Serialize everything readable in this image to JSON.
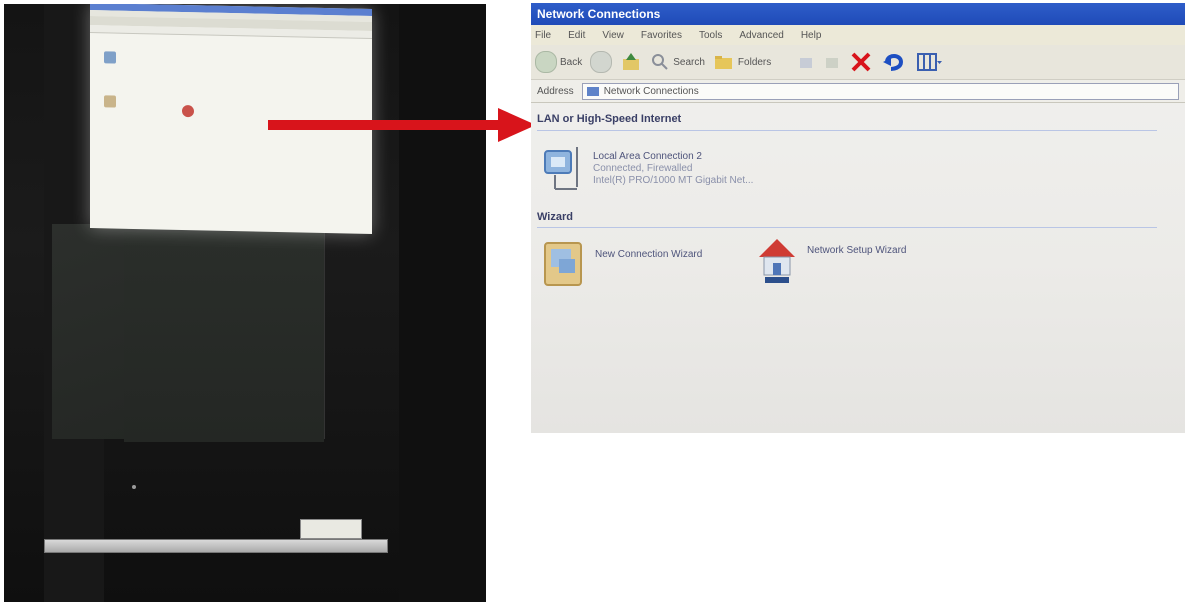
{
  "window": {
    "title": "Network Connections",
    "menu": [
      "File",
      "Edit",
      "View",
      "Favorites",
      "Tools",
      "Advanced",
      "Help"
    ],
    "toolbar": {
      "back_label": "Back",
      "search_label": "Search",
      "folders_label": "Folders"
    },
    "address": {
      "label": "Address",
      "value": "Network Connections"
    }
  },
  "groups": {
    "lan": {
      "title": "LAN or High-Speed Internet",
      "items": [
        {
          "name": "Local Area Connection 2",
          "status": "Connected, Firewalled",
          "device": "Intel(R) PRO/1000 MT Gigabit Net..."
        }
      ]
    },
    "wizard": {
      "title": "Wizard",
      "items": [
        {
          "name": "New Connection Wizard"
        },
        {
          "name": "Network Setup Wizard"
        }
      ]
    }
  },
  "colors": {
    "title_bar": "#2457c5",
    "arrow": "#d8141b",
    "group_text": "#3a3f66"
  },
  "icons": {
    "back": "back-arrow-icon",
    "forward": "forward-arrow-icon",
    "up": "folder-up-icon",
    "search": "search-icon",
    "folders": "folders-icon",
    "delete": "delete-x-icon",
    "undo": "undo-icon",
    "views": "views-icon"
  }
}
